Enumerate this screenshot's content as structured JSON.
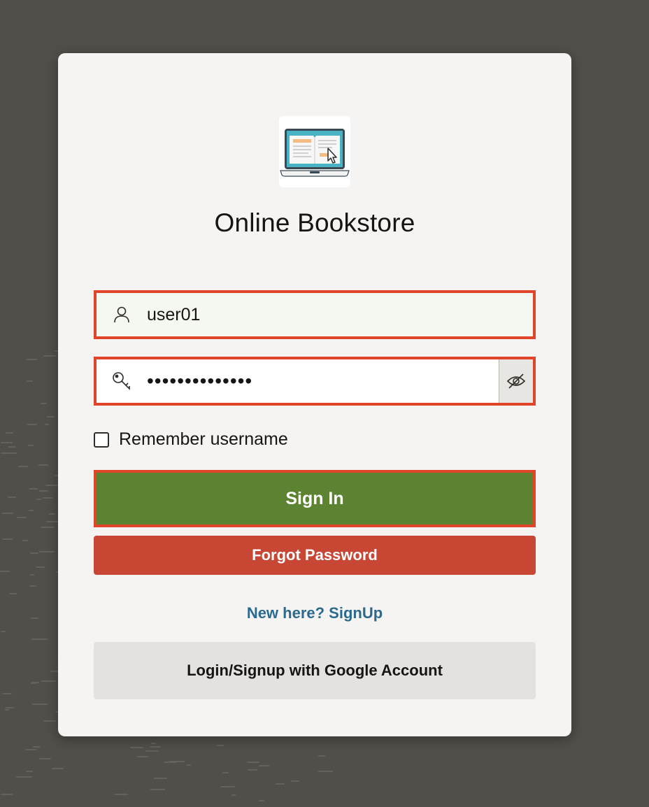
{
  "app": {
    "title": "Online Bookstore",
    "logo_icon": "laptop-book-icon"
  },
  "form": {
    "username": {
      "value": "user01",
      "icon": "user-icon"
    },
    "password": {
      "value": "••••••••••••••",
      "icon": "key-icon",
      "reveal_icon": "eye-slash-icon"
    },
    "remember": {
      "label": "Remember username",
      "checked": false
    }
  },
  "buttons": {
    "sign_in": "Sign In",
    "forgot_password": "Forgot Password",
    "signup_link": "New here? SignUp",
    "google": "Login/Signup with Google Account"
  },
  "colors": {
    "background": "#524f4a",
    "card": "#f5f4f2",
    "sign_in": "#5c8332",
    "forgot": "#c74634",
    "link": "#2b6a8e",
    "highlight_border": "#e0452a"
  }
}
